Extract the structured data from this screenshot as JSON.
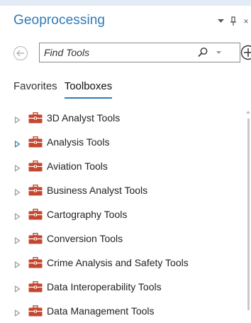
{
  "pane": {
    "title": "Geoprocessing",
    "controls": {
      "menu_icon": "chevron-down-icon",
      "pin_icon": "pin-icon",
      "close_icon": "close-icon",
      "close_label": "×"
    }
  },
  "search": {
    "placeholder": "Find Tools",
    "value": "",
    "icons": [
      "back-icon",
      "search-icon",
      "dropdown-icon",
      "add-icon"
    ]
  },
  "tabs": [
    {
      "label": "Favorites",
      "active": false
    },
    {
      "label": "Toolboxes",
      "active": true
    }
  ],
  "toolboxes": [
    {
      "label": "3D Analyst Tools"
    },
    {
      "label": "Analysis Tools"
    },
    {
      "label": "Aviation Tools"
    },
    {
      "label": "Business Analyst Tools"
    },
    {
      "label": "Cartography Tools"
    },
    {
      "label": "Conversion Tools"
    },
    {
      "label": "Crime Analysis and Safety Tools"
    },
    {
      "label": "Data Interoperability Tools"
    },
    {
      "label": "Data Management Tools"
    }
  ],
  "colors": {
    "accent": "#2f7bb8",
    "toolbox_icon": "#c4462e",
    "expander": "#9a9a9a",
    "expander_hover": "#2f7bb8"
  }
}
